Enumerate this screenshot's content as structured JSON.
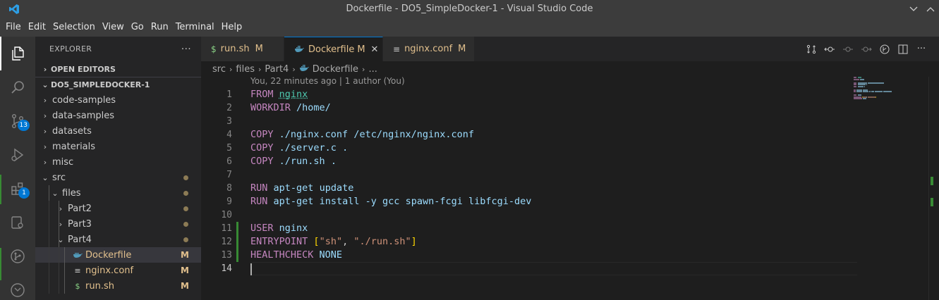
{
  "window": {
    "title": "Dockerfile - DO5_SimpleDocker-1 - Visual Studio Code"
  },
  "menu": [
    "File",
    "Edit",
    "Selection",
    "View",
    "Go",
    "Run",
    "Terminal",
    "Help"
  ],
  "activity_bar": {
    "source_control_badge": "13",
    "extensions_badge": "1"
  },
  "sidebar": {
    "title": "EXPLORER",
    "more_actions": "···",
    "open_editors_label": "OPEN EDITORS",
    "workspace_label": "DO5_SIMPLEDOCKER-1",
    "tree": [
      {
        "label": "code-samples",
        "depth": 1,
        "kind": "folder",
        "expanded": false
      },
      {
        "label": "data-samples",
        "depth": 1,
        "kind": "folder",
        "expanded": false
      },
      {
        "label": "datasets",
        "depth": 1,
        "kind": "folder",
        "expanded": false
      },
      {
        "label": "materials",
        "depth": 1,
        "kind": "folder",
        "expanded": false
      },
      {
        "label": "misc",
        "depth": 1,
        "kind": "folder",
        "expanded": false
      },
      {
        "label": "src",
        "depth": 1,
        "kind": "folder",
        "expanded": true,
        "dot": true
      },
      {
        "label": "files",
        "depth": 2,
        "kind": "folder",
        "expanded": true,
        "dot": true
      },
      {
        "label": "Part2",
        "depth": 3,
        "kind": "folder",
        "expanded": false,
        "dot": true
      },
      {
        "label": "Part3",
        "depth": 3,
        "kind": "folder",
        "expanded": false,
        "dot": true
      },
      {
        "label": "Part4",
        "depth": 3,
        "kind": "folder",
        "expanded": true,
        "dot": true
      },
      {
        "label": "Dockerfile",
        "depth": 4,
        "kind": "docker",
        "status": "M",
        "selected": true
      },
      {
        "label": "nginx.conf",
        "depth": 4,
        "kind": "conf",
        "status": "M"
      },
      {
        "label": "run.sh",
        "depth": 4,
        "kind": "shell",
        "status": "M"
      }
    ]
  },
  "tabs": [
    {
      "label": "run.sh",
      "icon": "$",
      "status": "M",
      "active": false
    },
    {
      "label": "Dockerfile",
      "icon": "docker",
      "status": "M",
      "active": true
    },
    {
      "label": "nginx.conf",
      "icon": "≡",
      "status": "M",
      "active": false
    }
  ],
  "breadcrumb": [
    "src",
    "files",
    "Part4",
    "Dockerfile",
    "..."
  ],
  "codelens": "You, 22 minutes ago | 1 author (You)",
  "editor": {
    "lines": [
      {
        "n": "1",
        "tokens": [
          [
            "kw",
            "FROM"
          ],
          [
            "ws",
            " "
          ],
          [
            "img",
            "nginx"
          ]
        ]
      },
      {
        "n": "2",
        "tokens": [
          [
            "kw",
            "WORKDIR"
          ],
          [
            "ws",
            " "
          ],
          [
            "arg",
            "/home/"
          ]
        ]
      },
      {
        "n": "3",
        "tokens": []
      },
      {
        "n": "4",
        "tokens": [
          [
            "kw",
            "COPY"
          ],
          [
            "ws",
            " "
          ],
          [
            "arg",
            "./nginx.conf"
          ],
          [
            "ws",
            " "
          ],
          [
            "arg",
            "/etc/nginx/nginx.conf"
          ]
        ]
      },
      {
        "n": "5",
        "tokens": [
          [
            "kw",
            "COPY"
          ],
          [
            "ws",
            " "
          ],
          [
            "arg",
            "./server.c"
          ],
          [
            "ws",
            " "
          ],
          [
            "arg",
            "."
          ]
        ]
      },
      {
        "n": "6",
        "tokens": [
          [
            "kw",
            "COPY"
          ],
          [
            "ws",
            " "
          ],
          [
            "arg",
            "./run.sh"
          ],
          [
            "ws",
            " "
          ],
          [
            "arg",
            "."
          ]
        ]
      },
      {
        "n": "7",
        "tokens": []
      },
      {
        "n": "8",
        "tokens": [
          [
            "kw",
            "RUN"
          ],
          [
            "ws",
            " "
          ],
          [
            "arg",
            "apt-get"
          ],
          [
            "ws",
            " "
          ],
          [
            "arg",
            "update"
          ]
        ]
      },
      {
        "n": "9",
        "tokens": [
          [
            "kw",
            "RUN"
          ],
          [
            "ws",
            " "
          ],
          [
            "arg",
            "apt-get"
          ],
          [
            "ws",
            " "
          ],
          [
            "arg",
            "install"
          ],
          [
            "ws",
            " "
          ],
          [
            "arg",
            "-y"
          ],
          [
            "ws",
            " "
          ],
          [
            "arg",
            "gcc"
          ],
          [
            "ws",
            " "
          ],
          [
            "arg",
            "spawn-fcgi"
          ],
          [
            "ws",
            " "
          ],
          [
            "arg",
            "libfcgi-dev"
          ]
        ]
      },
      {
        "n": "10",
        "tokens": []
      },
      {
        "n": "11",
        "tokens": [
          [
            "kw",
            "USER"
          ],
          [
            "ws",
            " "
          ],
          [
            "arg",
            "nginx"
          ]
        ]
      },
      {
        "n": "12",
        "tokens": [
          [
            "kw",
            "ENTRYPOINT"
          ],
          [
            "ws",
            " "
          ],
          [
            "brk",
            "["
          ],
          [
            "str",
            "\"sh\""
          ],
          [
            "punct",
            ","
          ],
          [
            "ws",
            " "
          ],
          [
            "str",
            "\"./run.sh\""
          ],
          [
            "brk",
            "]"
          ]
        ]
      },
      {
        "n": "13",
        "tokens": [
          [
            "kw",
            "HEALTHCHECK"
          ],
          [
            "ws",
            " "
          ],
          [
            "arg",
            "NONE"
          ]
        ]
      },
      {
        "n": "14",
        "tokens": [
          [
            "cursor",
            ""
          ]
        ]
      }
    ],
    "current_line": "14"
  },
  "colors": {
    "accent": "#0078d4",
    "git_added": "#388a34",
    "modified": "#e2c08d",
    "keyword": "#c586c0",
    "string": "#ce9178",
    "argument": "#9cdcfe"
  }
}
